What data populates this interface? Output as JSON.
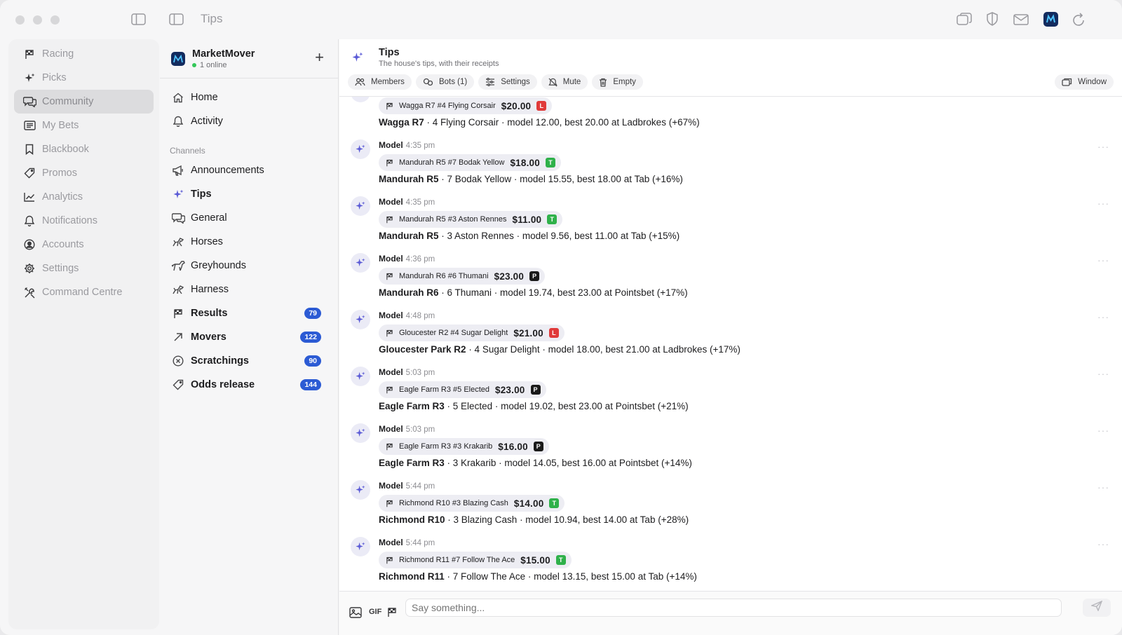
{
  "app": {
    "title": "Tips"
  },
  "sidebar": {
    "items": [
      {
        "label": "Racing",
        "icon": "flag-icon",
        "active": false
      },
      {
        "label": "Picks",
        "icon": "sparkle-icon",
        "active": false
      },
      {
        "label": "Community",
        "icon": "chat-icon",
        "active": true
      },
      {
        "label": "My Bets",
        "icon": "ticket-icon",
        "active": false
      },
      {
        "label": "Blackbook",
        "icon": "bookmark-icon",
        "active": false
      },
      {
        "label": "Promos",
        "icon": "tag-icon",
        "active": false
      },
      {
        "label": "Analytics",
        "icon": "chart-icon",
        "active": false
      },
      {
        "label": "Notifications",
        "icon": "bell-icon",
        "active": false
      },
      {
        "label": "Accounts",
        "icon": "user-circle-icon",
        "active": false
      },
      {
        "label": "Settings",
        "icon": "gear-icon",
        "active": false
      },
      {
        "label": "Command Centre",
        "icon": "tools-icon",
        "active": false
      }
    ]
  },
  "server": {
    "name": "MarketMover",
    "status": "1 online"
  },
  "channels_nav": {
    "top": [
      {
        "label": "Home",
        "icon": "home-icon"
      },
      {
        "label": "Activity",
        "icon": "bell-icon"
      }
    ],
    "section_label": "Channels",
    "channels": [
      {
        "label": "Announcements",
        "icon": "megaphone-icon",
        "bold": false,
        "badge": ""
      },
      {
        "label": "Tips",
        "icon": "sparkle-icon",
        "bold": true,
        "badge": ""
      },
      {
        "label": "General",
        "icon": "chat-icon",
        "bold": false,
        "badge": ""
      },
      {
        "label": "Horses",
        "icon": "horse-icon",
        "bold": false,
        "badge": ""
      },
      {
        "label": "Greyhounds",
        "icon": "dog-icon",
        "bold": false,
        "badge": ""
      },
      {
        "label": "Harness",
        "icon": "horse-icon",
        "bold": false,
        "badge": ""
      },
      {
        "label": "Results",
        "icon": "flag-icon",
        "bold": true,
        "badge": "79"
      },
      {
        "label": "Movers",
        "icon": "arrow-up-right-icon",
        "bold": true,
        "badge": "122"
      },
      {
        "label": "Scratchings",
        "icon": "x-circle-icon",
        "bold": true,
        "badge": "90"
      },
      {
        "label": "Odds release",
        "icon": "tag-icon",
        "bold": true,
        "badge": "144"
      }
    ]
  },
  "channel": {
    "title": "Tips",
    "subtitle": "The house's tips, with their receipts",
    "toolbar": {
      "members": "Members",
      "bots": "Bots (1)",
      "settings": "Settings",
      "mute": "Mute",
      "empty": "Empty",
      "window": "Window"
    }
  },
  "messages": [
    {
      "author": "",
      "time": "",
      "pill": "Wagga R7 #4 Flying Corsair",
      "price": "$20.00",
      "bookie": "lad",
      "race": "Wagga R7",
      "detail": " · 4 Flying Corsair · model 12.00, best 20.00 at Ladbrokes (+67%)"
    },
    {
      "author": "Model",
      "time": "4:35 pm",
      "pill": "Mandurah R5 #7 Bodak Yellow",
      "price": "$18.00",
      "bookie": "tab",
      "race": "Mandurah R5",
      "detail": " · 7 Bodak Yellow · model 15.55, best 18.00 at Tab (+16%)"
    },
    {
      "author": "Model",
      "time": "4:35 pm",
      "pill": "Mandurah R5 #3 Aston Rennes",
      "price": "$11.00",
      "bookie": "tab",
      "race": "Mandurah R5",
      "detail": " · 3 Aston Rennes · model 9.56, best 11.00 at Tab (+15%)"
    },
    {
      "author": "Model",
      "time": "4:36 pm",
      "pill": "Mandurah R6 #6 Thumani",
      "price": "$23.00",
      "bookie": "pb",
      "race": "Mandurah R6",
      "detail": " · 6 Thumani · model 19.74, best 23.00 at Pointsbet (+17%)"
    },
    {
      "author": "Model",
      "time": "4:48 pm",
      "pill": "Gloucester R2 #4 Sugar Delight",
      "price": "$21.00",
      "bookie": "lad",
      "race": "Gloucester Park R2",
      "detail": " · 4 Sugar Delight · model 18.00, best 21.00 at Ladbrokes (+17%)"
    },
    {
      "author": "Model",
      "time": "5:03 pm",
      "pill": "Eagle Farm R3 #5 Elected",
      "price": "$23.00",
      "bookie": "pb",
      "race": "Eagle Farm R3",
      "detail": " · 5 Elected · model 19.02, best 23.00 at Pointsbet (+21%)"
    },
    {
      "author": "Model",
      "time": "5:03 pm",
      "pill": "Eagle Farm R3 #3 Krakarib",
      "price": "$16.00",
      "bookie": "pb",
      "race": "Eagle Farm R3",
      "detail": " · 3 Krakarib · model 14.05, best 16.00 at Pointsbet (+14%)"
    },
    {
      "author": "Model",
      "time": "5:44 pm",
      "pill": "Richmond R10 #3 Blazing Cash",
      "price": "$14.00",
      "bookie": "tab",
      "race": "Richmond R10",
      "detail": " · 3 Blazing Cash · model 10.94, best 14.00 at Tab (+28%)"
    },
    {
      "author": "Model",
      "time": "5:44 pm",
      "pill": "Richmond R11 #7 Follow The Ace",
      "price": "$15.00",
      "bookie": "tab",
      "race": "Richmond R11",
      "detail": " · 7 Follow The Ace · model 13.15, best 15.00 at Tab (+14%)"
    }
  ],
  "composer": {
    "gif_label": "GIF",
    "placeholder": "Say something..."
  },
  "colors": {
    "accent": "#5b5bd6",
    "badge": "#2c5bd4",
    "ladbrokes": "#e03a3a",
    "tab": "#2fb14a",
    "pointsbet": "#1a1a1a"
  }
}
